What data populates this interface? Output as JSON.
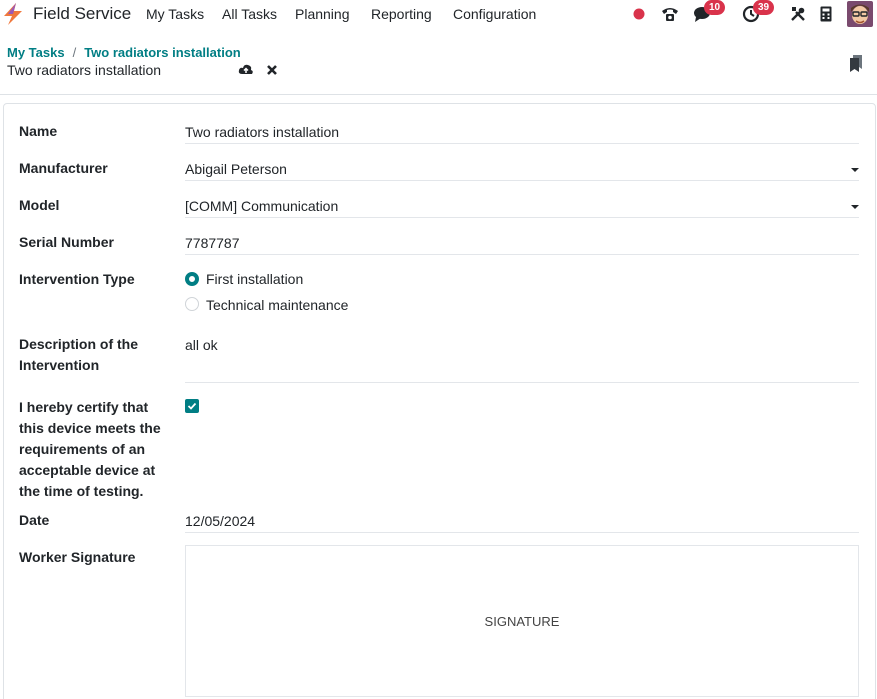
{
  "navbar": {
    "app_name": "Field Service",
    "menu": [
      "My Tasks",
      "All Tasks",
      "Planning",
      "Reporting",
      "Configuration"
    ],
    "messages_count": "10",
    "activities_count": "39",
    "record_dot_color": "#d9334b"
  },
  "breadcrumb": {
    "parent": "My Tasks",
    "separator": "/",
    "current": "Two radiators installation"
  },
  "record_title": "Two radiators installation",
  "form": {
    "name_label": "Name",
    "name_value": "Two radiators installation",
    "manufacturer_label": "Manufacturer",
    "manufacturer_value": "Abigail Peterson",
    "model_label": "Model",
    "model_value": "[COMM] Communication",
    "serial_label": "Serial Number",
    "serial_value": "7787787",
    "intervention_label": "Intervention Type",
    "intervention_options": [
      "First installation",
      "Technical maintenance"
    ],
    "intervention_selected": "First installation",
    "description_label": "Description of the Intervention",
    "description_value": "all ok",
    "certify_label": "I hereby certify that this device meets the requirements of an acceptable device at the time of testing.",
    "certify_checked": true,
    "date_label": "Date",
    "date_value": "12/05/2024",
    "signature_label": "Worker Signature",
    "signature_placeholder": "SIGNATURE"
  },
  "colors": {
    "accent": "#017e84",
    "badge": "#d9334b"
  }
}
